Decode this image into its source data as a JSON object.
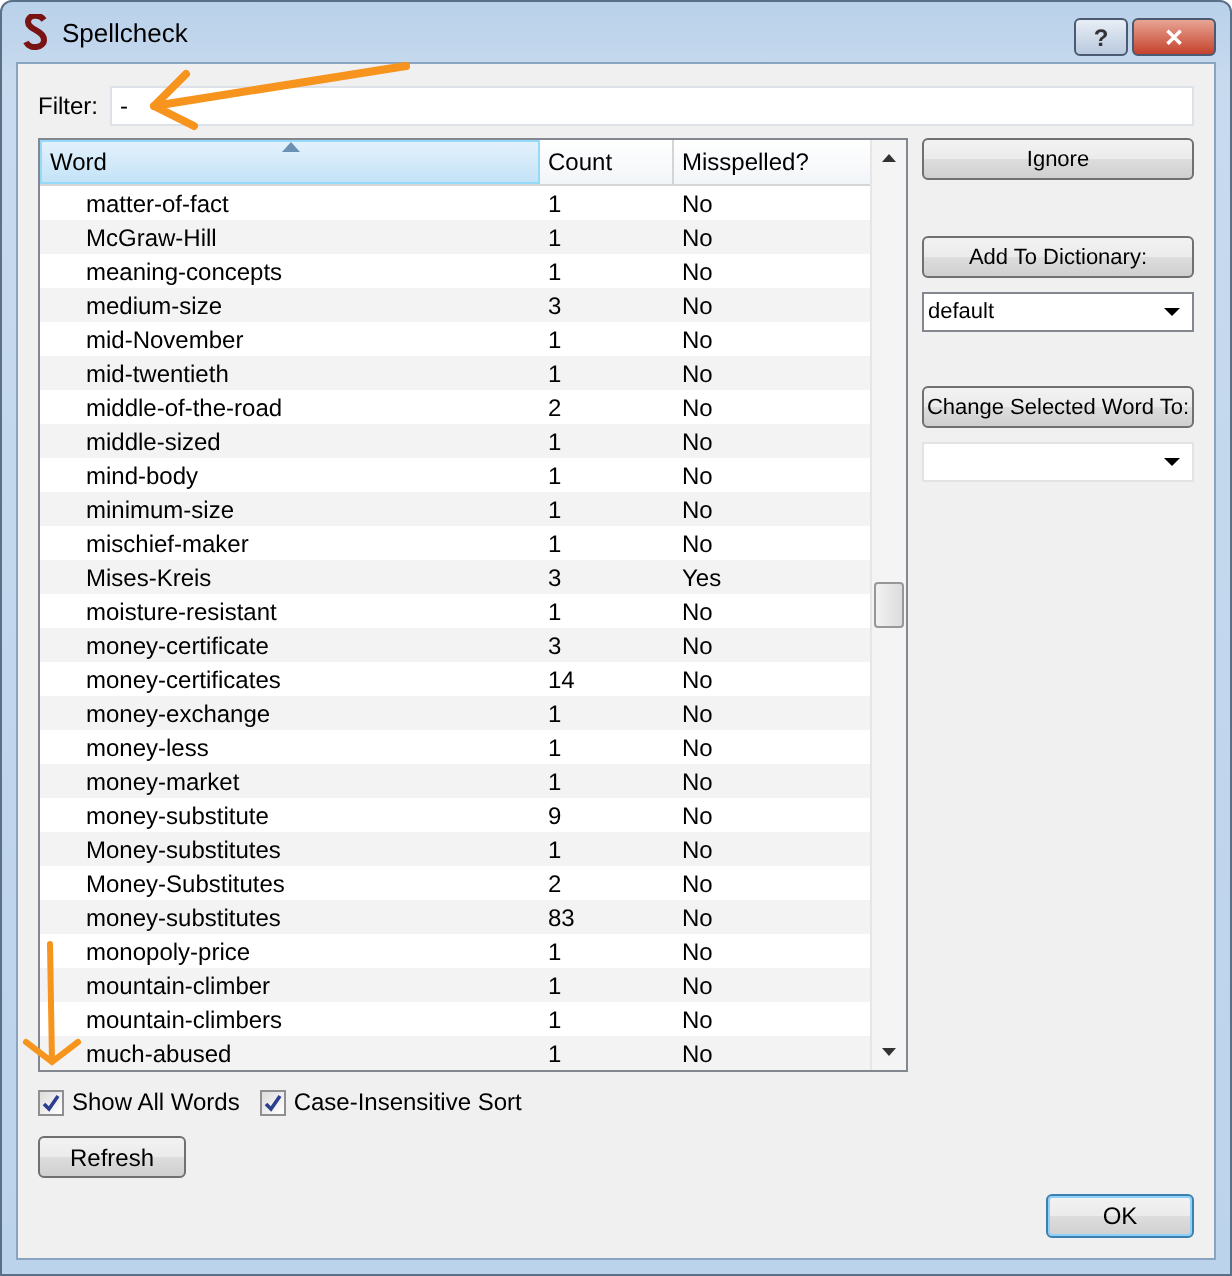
{
  "window": {
    "title": "Spellcheck",
    "buttons": [
      {
        "kind": "help",
        "label": "?"
      },
      {
        "kind": "close",
        "label": "✕"
      }
    ]
  },
  "filter": {
    "label": "Filter:",
    "value": "-"
  },
  "table": {
    "columns": [
      "Word",
      "Count",
      "Misspelled?"
    ],
    "rows": [
      {
        "word": "matter-of-fact",
        "count": "1",
        "misspelled": "No"
      },
      {
        "word": "McGraw-Hill",
        "count": "1",
        "misspelled": "No"
      },
      {
        "word": "meaning-concepts",
        "count": "1",
        "misspelled": "No"
      },
      {
        "word": "medium-size",
        "count": "3",
        "misspelled": "No"
      },
      {
        "word": "mid-November",
        "count": "1",
        "misspelled": "No"
      },
      {
        "word": "mid-twentieth",
        "count": "1",
        "misspelled": "No"
      },
      {
        "word": "middle-of-the-road",
        "count": "2",
        "misspelled": "No"
      },
      {
        "word": "middle-sized",
        "count": "1",
        "misspelled": "No"
      },
      {
        "word": "mind-body",
        "count": "1",
        "misspelled": "No"
      },
      {
        "word": "minimum-size",
        "count": "1",
        "misspelled": "No"
      },
      {
        "word": "mischief-maker",
        "count": "1",
        "misspelled": "No"
      },
      {
        "word": "Mises-Kreis",
        "count": "3",
        "misspelled": "Yes"
      },
      {
        "word": "moisture-resistant",
        "count": "1",
        "misspelled": "No"
      },
      {
        "word": "money-certificate",
        "count": "3",
        "misspelled": "No"
      },
      {
        "word": "money-certificates",
        "count": "14",
        "misspelled": "No"
      },
      {
        "word": "money-exchange",
        "count": "1",
        "misspelled": "No"
      },
      {
        "word": "money-less",
        "count": "1",
        "misspelled": "No"
      },
      {
        "word": "money-market",
        "count": "1",
        "misspelled": "No"
      },
      {
        "word": "money-substitute",
        "count": "9",
        "misspelled": "No"
      },
      {
        "word": "Money-substitutes",
        "count": "1",
        "misspelled": "No"
      },
      {
        "word": "Money-Substitutes",
        "count": "2",
        "misspelled": "No"
      },
      {
        "word": "money-substitutes",
        "count": "83",
        "misspelled": "No"
      },
      {
        "word": "monopoly-price",
        "count": "1",
        "misspelled": "No"
      },
      {
        "word": "mountain-climber",
        "count": "1",
        "misspelled": "No"
      },
      {
        "word": "mountain-climbers",
        "count": "1",
        "misspelled": "No"
      },
      {
        "word": "much-abused",
        "count": "1",
        "misspelled": "No"
      }
    ]
  },
  "side": {
    "ignore": "Ignore",
    "add": "Add To Dictionary:",
    "dictionary": "default",
    "change": "Change Selected Word To:"
  },
  "options": [
    {
      "label": "Show All Words",
      "checked": true
    },
    {
      "label": "Case-Insensitive Sort",
      "checked": true
    }
  ],
  "refresh": "Refresh",
  "ok": "OK"
}
